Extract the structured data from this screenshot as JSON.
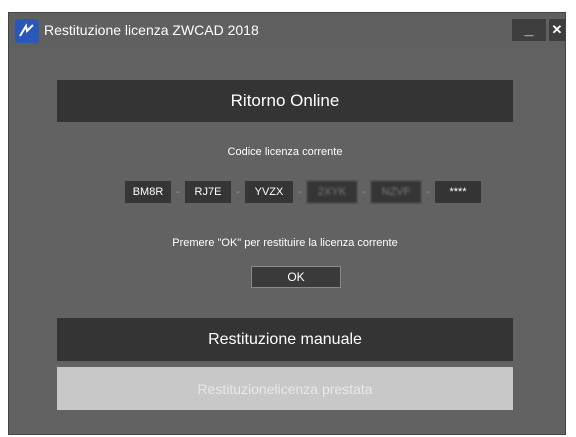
{
  "window": {
    "title": "Restituzione licenza ZWCAD 2018",
    "minimize_label": "_",
    "close_label": "✕"
  },
  "online": {
    "header": "Ritorno Online",
    "license_label": "Codice licenza corrente",
    "key_segments": [
      "BM8R",
      "RJ7E",
      "YVZX",
      "2XYK",
      "NZVF",
      "****"
    ],
    "separator": "-",
    "instruction": "Premere \"OK\" per restituire la licenza corrente",
    "ok_label": "OK"
  },
  "manual": {
    "header": "Restituzione manuale",
    "loan_return_label": "Restituzionelicenza prestata"
  },
  "colors": {
    "window_bg": "#626262",
    "panel_bg": "#343434",
    "disabled_bg": "#c8c8c8",
    "app_icon": "#2a58b8"
  }
}
